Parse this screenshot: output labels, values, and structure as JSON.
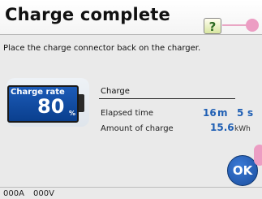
{
  "header": {
    "title": "Charge complete",
    "help_label": "?"
  },
  "instruction": "Place the charge connector back on the charger.",
  "battery": {
    "label": "Charge rate",
    "value": "80",
    "unit": "%"
  },
  "charge": {
    "section_title": "Charge",
    "elapsed_label": "Elapsed time",
    "elapsed_minutes": "16",
    "elapsed_minutes_unit": "m",
    "elapsed_seconds": "5",
    "elapsed_seconds_unit": "s",
    "amount_label": "Amount of charge",
    "amount_value": "15.6",
    "amount_unit": "kWh"
  },
  "ok_label": "OK",
  "footer": {
    "current": "000A",
    "voltage": "000V"
  },
  "colors": {
    "accent": "#1f5fb4",
    "pink_marker": "#ec9dc3",
    "help_green": "#2e6b22"
  }
}
